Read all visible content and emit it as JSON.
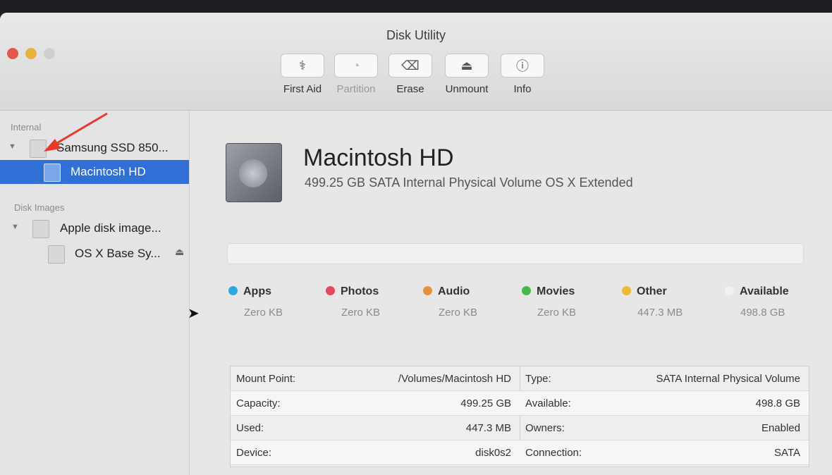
{
  "window": {
    "title": "Disk Utility"
  },
  "toolbar": [
    {
      "label": "First Aid",
      "icon": "stethoscope-icon",
      "glyph": "⚕",
      "disabled": false
    },
    {
      "label": "Partition",
      "icon": "pie-chart-icon",
      "glyph": "◔",
      "disabled": true
    },
    {
      "label": "Erase",
      "icon": "erase-drive-icon",
      "glyph": "⌫",
      "disabled": false
    },
    {
      "label": "Unmount",
      "icon": "eject-icon",
      "glyph": "⏏",
      "disabled": false
    },
    {
      "label": "Info",
      "icon": "info-icon",
      "glyph": "ⓘ",
      "disabled": false
    }
  ],
  "sidebar": {
    "internal_header": "Internal",
    "disk_images_header": "Disk Images",
    "items": [
      {
        "label": "Samsung SSD 850..."
      },
      {
        "label": "Macintosh HD"
      },
      {
        "label": "Apple disk image..."
      },
      {
        "label": "OS X Base Sy..."
      }
    ],
    "eject_glyph": "⏏"
  },
  "volume": {
    "name": "Macintosh HD",
    "description": "499.25 GB SATA Internal Physical Volume OS X Extended"
  },
  "legend": [
    {
      "name": "Apps",
      "value": "Zero KB",
      "color": "#2fa8e0"
    },
    {
      "name": "Photos",
      "value": "Zero KB",
      "color": "#e04a5c"
    },
    {
      "name": "Audio",
      "value": "Zero KB",
      "color": "#e8913c"
    },
    {
      "name": "Movies",
      "value": "Zero KB",
      "color": "#4db84a"
    },
    {
      "name": "Other",
      "value": "447.3 MB",
      "color": "#f0b934"
    },
    {
      "name": "Available",
      "value": "498.8 GB",
      "color": "#f1f1f1"
    }
  ],
  "info": {
    "left": [
      {
        "key": "Mount Point:",
        "value": "/Volumes/Macintosh HD"
      },
      {
        "key": "Capacity:",
        "value": "499.25 GB"
      },
      {
        "key": "Used:",
        "value": "447.3 MB"
      },
      {
        "key": "Device:",
        "value": "disk0s2"
      }
    ],
    "right": [
      {
        "key": "Type:",
        "value": "SATA Internal Physical Volume"
      },
      {
        "key": "Available:",
        "value": "498.8 GB"
      },
      {
        "key": "Owners:",
        "value": "Enabled"
      },
      {
        "key": "Connection:",
        "value": "SATA"
      }
    ]
  },
  "colors": {
    "selection": "#2f6fd6",
    "annotation_arrow": "#e8392b"
  }
}
